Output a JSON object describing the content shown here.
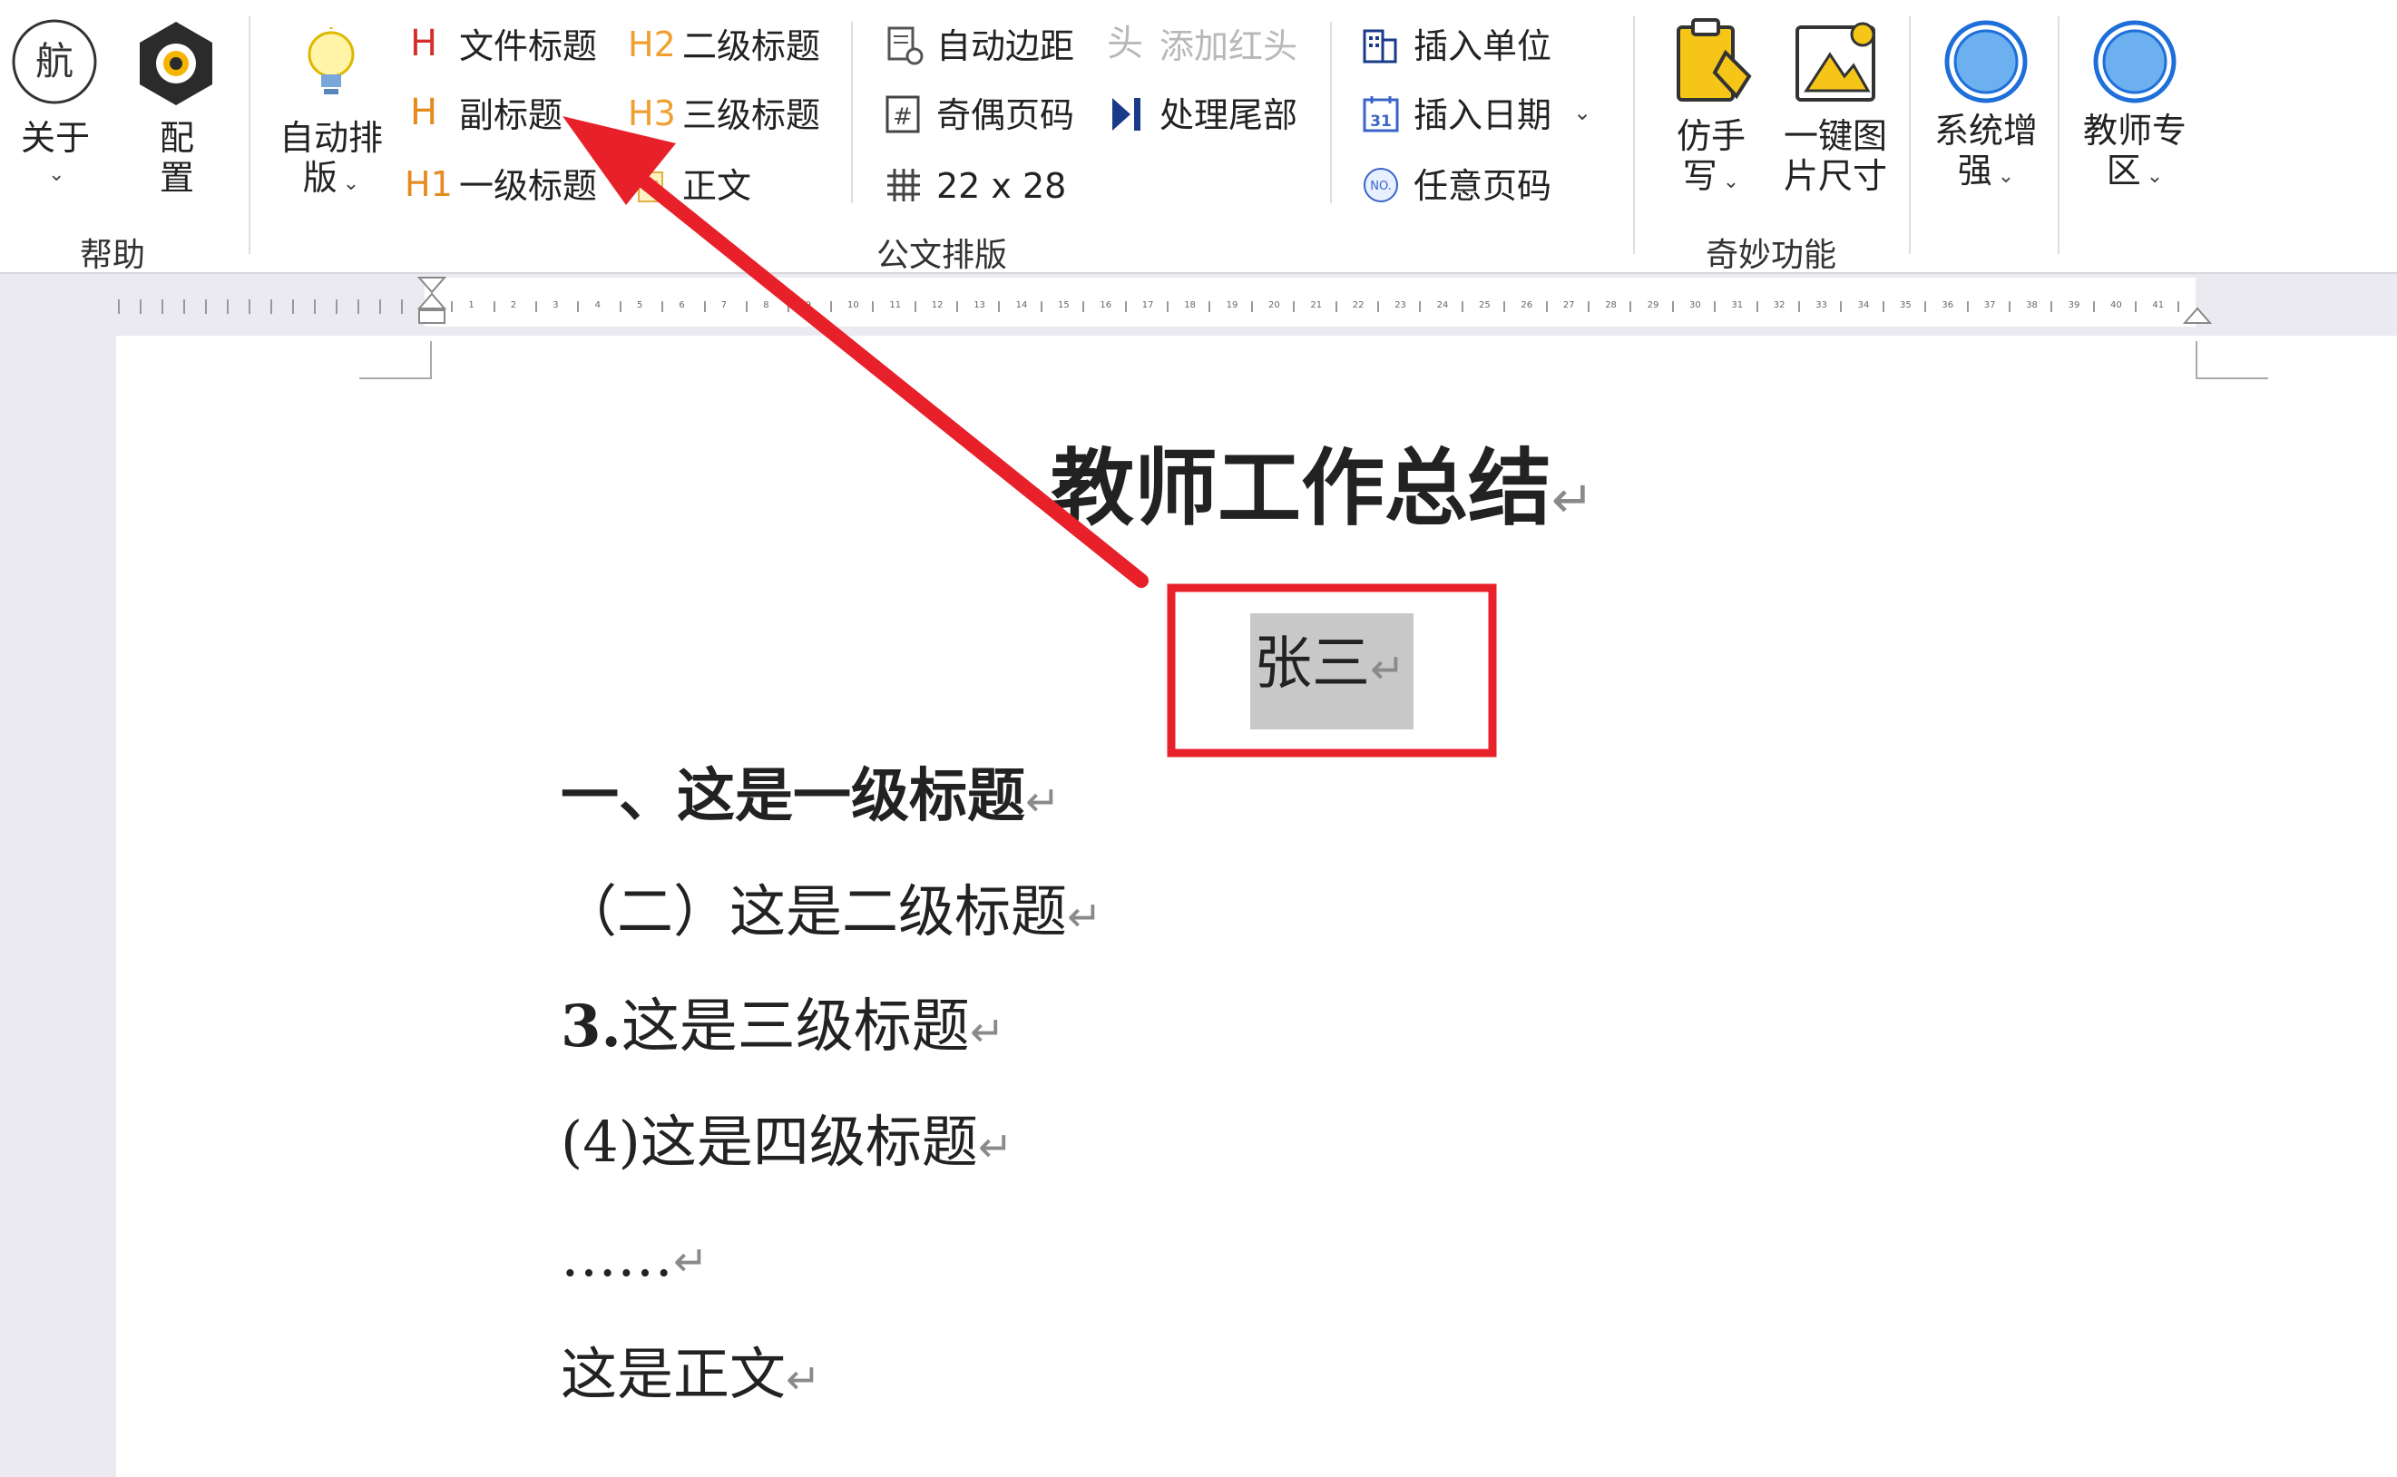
{
  "ribbon": {
    "help_group": {
      "label": "帮助",
      "about_label": "关于",
      "config_line1": "配",
      "config_line2": "置"
    },
    "format_group": {
      "label": "公文排版",
      "auto_layout_line1": "自动排",
      "auto_layout_line2": "版",
      "file_title": "文件标题",
      "subtitle": "副标题",
      "h1": "一级标题",
      "h2": "二级标题",
      "h3": "三级标题",
      "body": "正文",
      "auto_margin": "自动边距",
      "odd_even_page": "奇偶页码",
      "grid_size": "22 x 28",
      "add_red_header": "添加红头",
      "process_tail": "处理尾部",
      "insert_unit": "插入单位",
      "insert_date": "插入日期",
      "any_page_number": "任意页码"
    },
    "wonder_group": {
      "label": "奇妙功能",
      "imitate_line1": "仿手",
      "imitate_line2": "写",
      "image_size_line1": "一键图",
      "image_size_line2": "片尺寸"
    },
    "system_line1": "系统增",
    "system_line2": "强",
    "teacher_line1": "教师专",
    "teacher_line2": "区",
    "icon_glyphs": {
      "h_plain": "H",
      "h1": "H1",
      "h2": "H2",
      "h3": "H3",
      "tou": "头",
      "no": "NO.",
      "cal": "31"
    }
  },
  "ruler": {
    "numbers": [
      "1",
      "2",
      "3",
      "4",
      "5",
      "6",
      "7",
      "8",
      "9",
      "10",
      "11",
      "12",
      "13",
      "14",
      "15",
      "16",
      "17",
      "18",
      "19",
      "20",
      "21",
      "22",
      "23",
      "24",
      "25",
      "26",
      "27",
      "28",
      "29",
      "30",
      "31",
      "32",
      "33",
      "34",
      "35",
      "36",
      "37",
      "38",
      "39",
      "40",
      "41"
    ]
  },
  "document": {
    "title": "教师工作总结",
    "author": "张三",
    "heading1": "一、这是一级标题",
    "heading2": "（二）这是二级标题",
    "heading3_num": "3.",
    "heading3_text": "这是三级标题",
    "heading4": "(4)这是四级标题",
    "ellipsis": "……",
    "body": "这是正文",
    "para_mark": "↵"
  },
  "annotation": {
    "arrow_color": "#e8202a",
    "box_color": "#e8202a"
  },
  "colors": {
    "h_red": "#d32f2f",
    "h_orange": "#e58a1f",
    "selection": "#c8c8c8"
  }
}
